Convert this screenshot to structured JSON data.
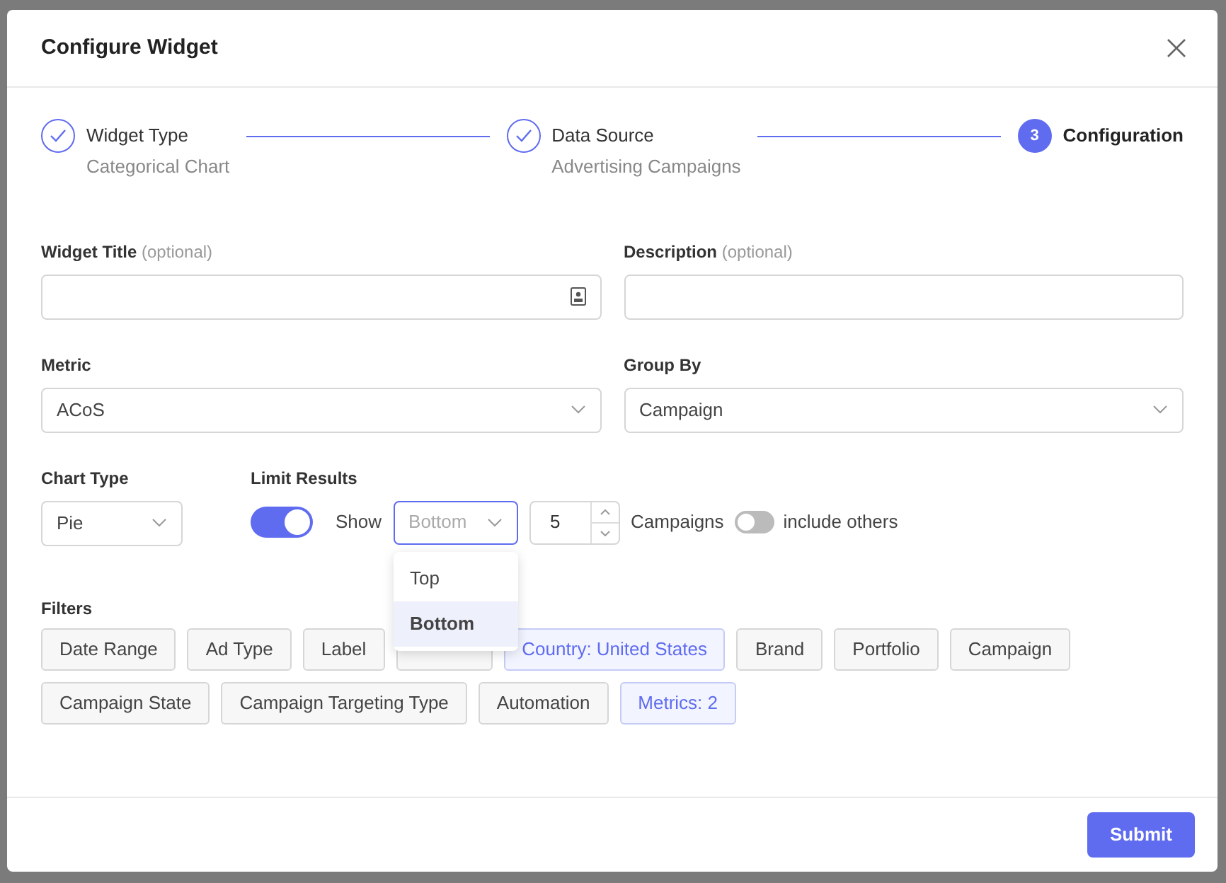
{
  "dialog": {
    "title": "Configure Widget"
  },
  "steps": [
    {
      "title": "Widget Type",
      "subtitle": "Categorical Chart",
      "done": true
    },
    {
      "title": "Data Source",
      "subtitle": "Advertising Campaigns",
      "done": true
    },
    {
      "title": "Configuration",
      "number": "3",
      "done": false
    }
  ],
  "fields": [
    {
      "label": "Widget Title",
      "hint": "(optional)",
      "kind": "text",
      "icon": true
    },
    {
      "label": "Description",
      "hint": "(optional)",
      "kind": "text"
    },
    {
      "label": "Metric",
      "kind": "select",
      "value": "ACoS"
    },
    {
      "label": "Group By",
      "kind": "select",
      "value": "Campaign"
    }
  ],
  "chart_type": {
    "label": "Chart Type",
    "value": "Pie"
  },
  "limit_results": {
    "label": "Limit Results",
    "on": true,
    "show_label": "Show",
    "placeholder": "Bottom",
    "open": true,
    "options": [
      {
        "label": "Top",
        "selected": false
      },
      {
        "label": "Bottom",
        "selected": true
      }
    ],
    "count": "5",
    "unit": "Campaigns",
    "include_others": {
      "label": "include others",
      "on": false
    }
  },
  "filters": {
    "label": "Filters",
    "items": [
      {
        "label": "Date Range",
        "active": false
      },
      {
        "label": "Ad Type",
        "active": false
      },
      {
        "label": "Label",
        "active": false
      },
      {
        "covered": true,
        "active": false
      },
      {
        "label": "Country: United States",
        "active": true
      },
      {
        "label": "Brand",
        "active": false
      },
      {
        "label": "Portfolio",
        "active": false
      },
      {
        "label": "Campaign",
        "active": false
      },
      {
        "label": "Campaign State",
        "active": false
      },
      {
        "label": "Campaign Targeting Type",
        "active": false
      },
      {
        "label": "Automation",
        "active": false
      },
      {
        "label": "Metrics: 2",
        "active": true
      }
    ]
  },
  "submit": "Submit"
}
